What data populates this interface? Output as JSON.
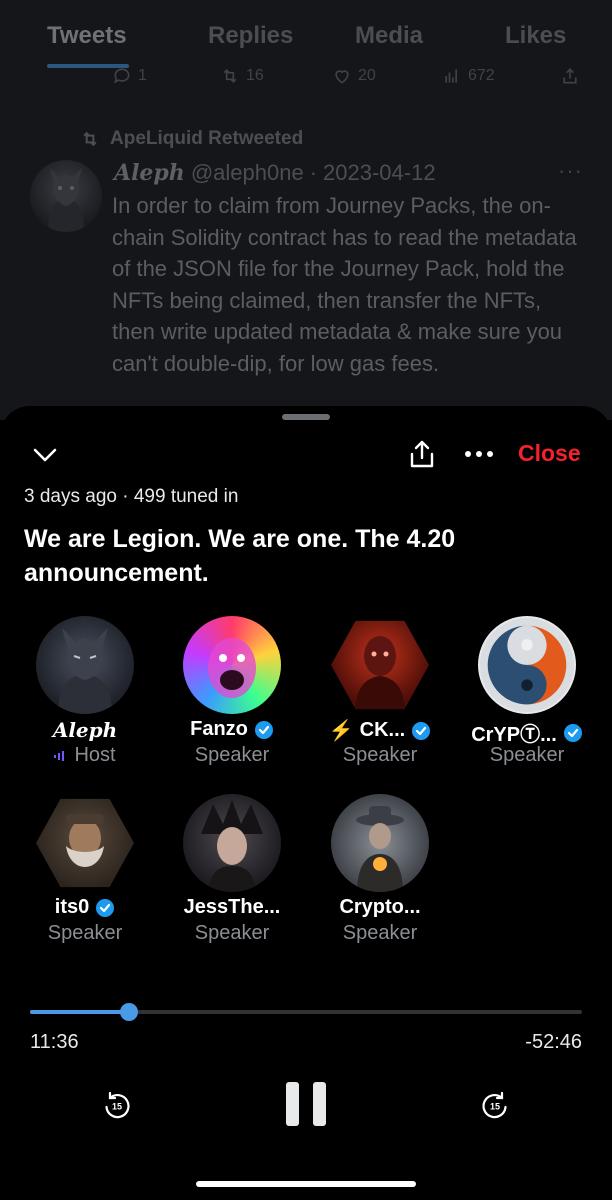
{
  "tabs": [
    {
      "label": "Tweets",
      "active": true
    },
    {
      "label": "Replies",
      "active": false
    },
    {
      "label": "Media",
      "active": false
    },
    {
      "label": "Likes",
      "active": false
    }
  ],
  "tweet_actions": {
    "replies": "1",
    "retweets": "16",
    "likes": "20",
    "views": "672"
  },
  "tweet": {
    "retweeted_by": "ApeLiquid Retweeted",
    "author_name": "Aleph",
    "author_handle": "@aleph0ne",
    "date": "2023-04-12",
    "separator": "·",
    "more": "···",
    "text": "In order to claim from Journey Packs, the on-chain Solidity contract has to read the metadata of the JSON file for the Journey Pack, hold the NFTs being claimed, then transfer the NFTs, then write updated metadata & make sure you can't double-dip, for low gas fees."
  },
  "space": {
    "close_label": "Close",
    "meta": "3 days ago · 499 tuned in",
    "title": "We are Legion. We are one. The 4.20 announcement.",
    "participants": [
      {
        "name": "Aleph",
        "role": "Host",
        "verified": false,
        "gothic": true,
        "prefix": ""
      },
      {
        "name": "Fanzo",
        "role": "Speaker",
        "verified": true,
        "gothic": false,
        "prefix": ""
      },
      {
        "name": "CK...",
        "role": "Speaker",
        "verified": true,
        "gothic": false,
        "prefix": "⚡"
      },
      {
        "name": "CrYPⓉ...",
        "role": "Speaker",
        "verified": true,
        "gothic": false,
        "prefix": ""
      },
      {
        "name": "its0",
        "role": "Speaker",
        "verified": true,
        "gothic": false,
        "prefix": ""
      },
      {
        "name": "JessThe...",
        "role": "Speaker",
        "verified": false,
        "gothic": false,
        "prefix": ""
      },
      {
        "name": "Crypto...",
        "role": "Speaker",
        "verified": false,
        "gothic": false,
        "prefix": ""
      }
    ],
    "playback": {
      "elapsed": "11:36",
      "remaining": "-52:46",
      "progress_fraction": 0.18,
      "skip_back_label": "15",
      "skip_forward_label": "15"
    }
  },
  "colors": {
    "accent_blue": "#4a9be5",
    "close_red": "#f4212e",
    "verified_blue": "#1d9bf0",
    "host_purple": "#7856ff"
  }
}
